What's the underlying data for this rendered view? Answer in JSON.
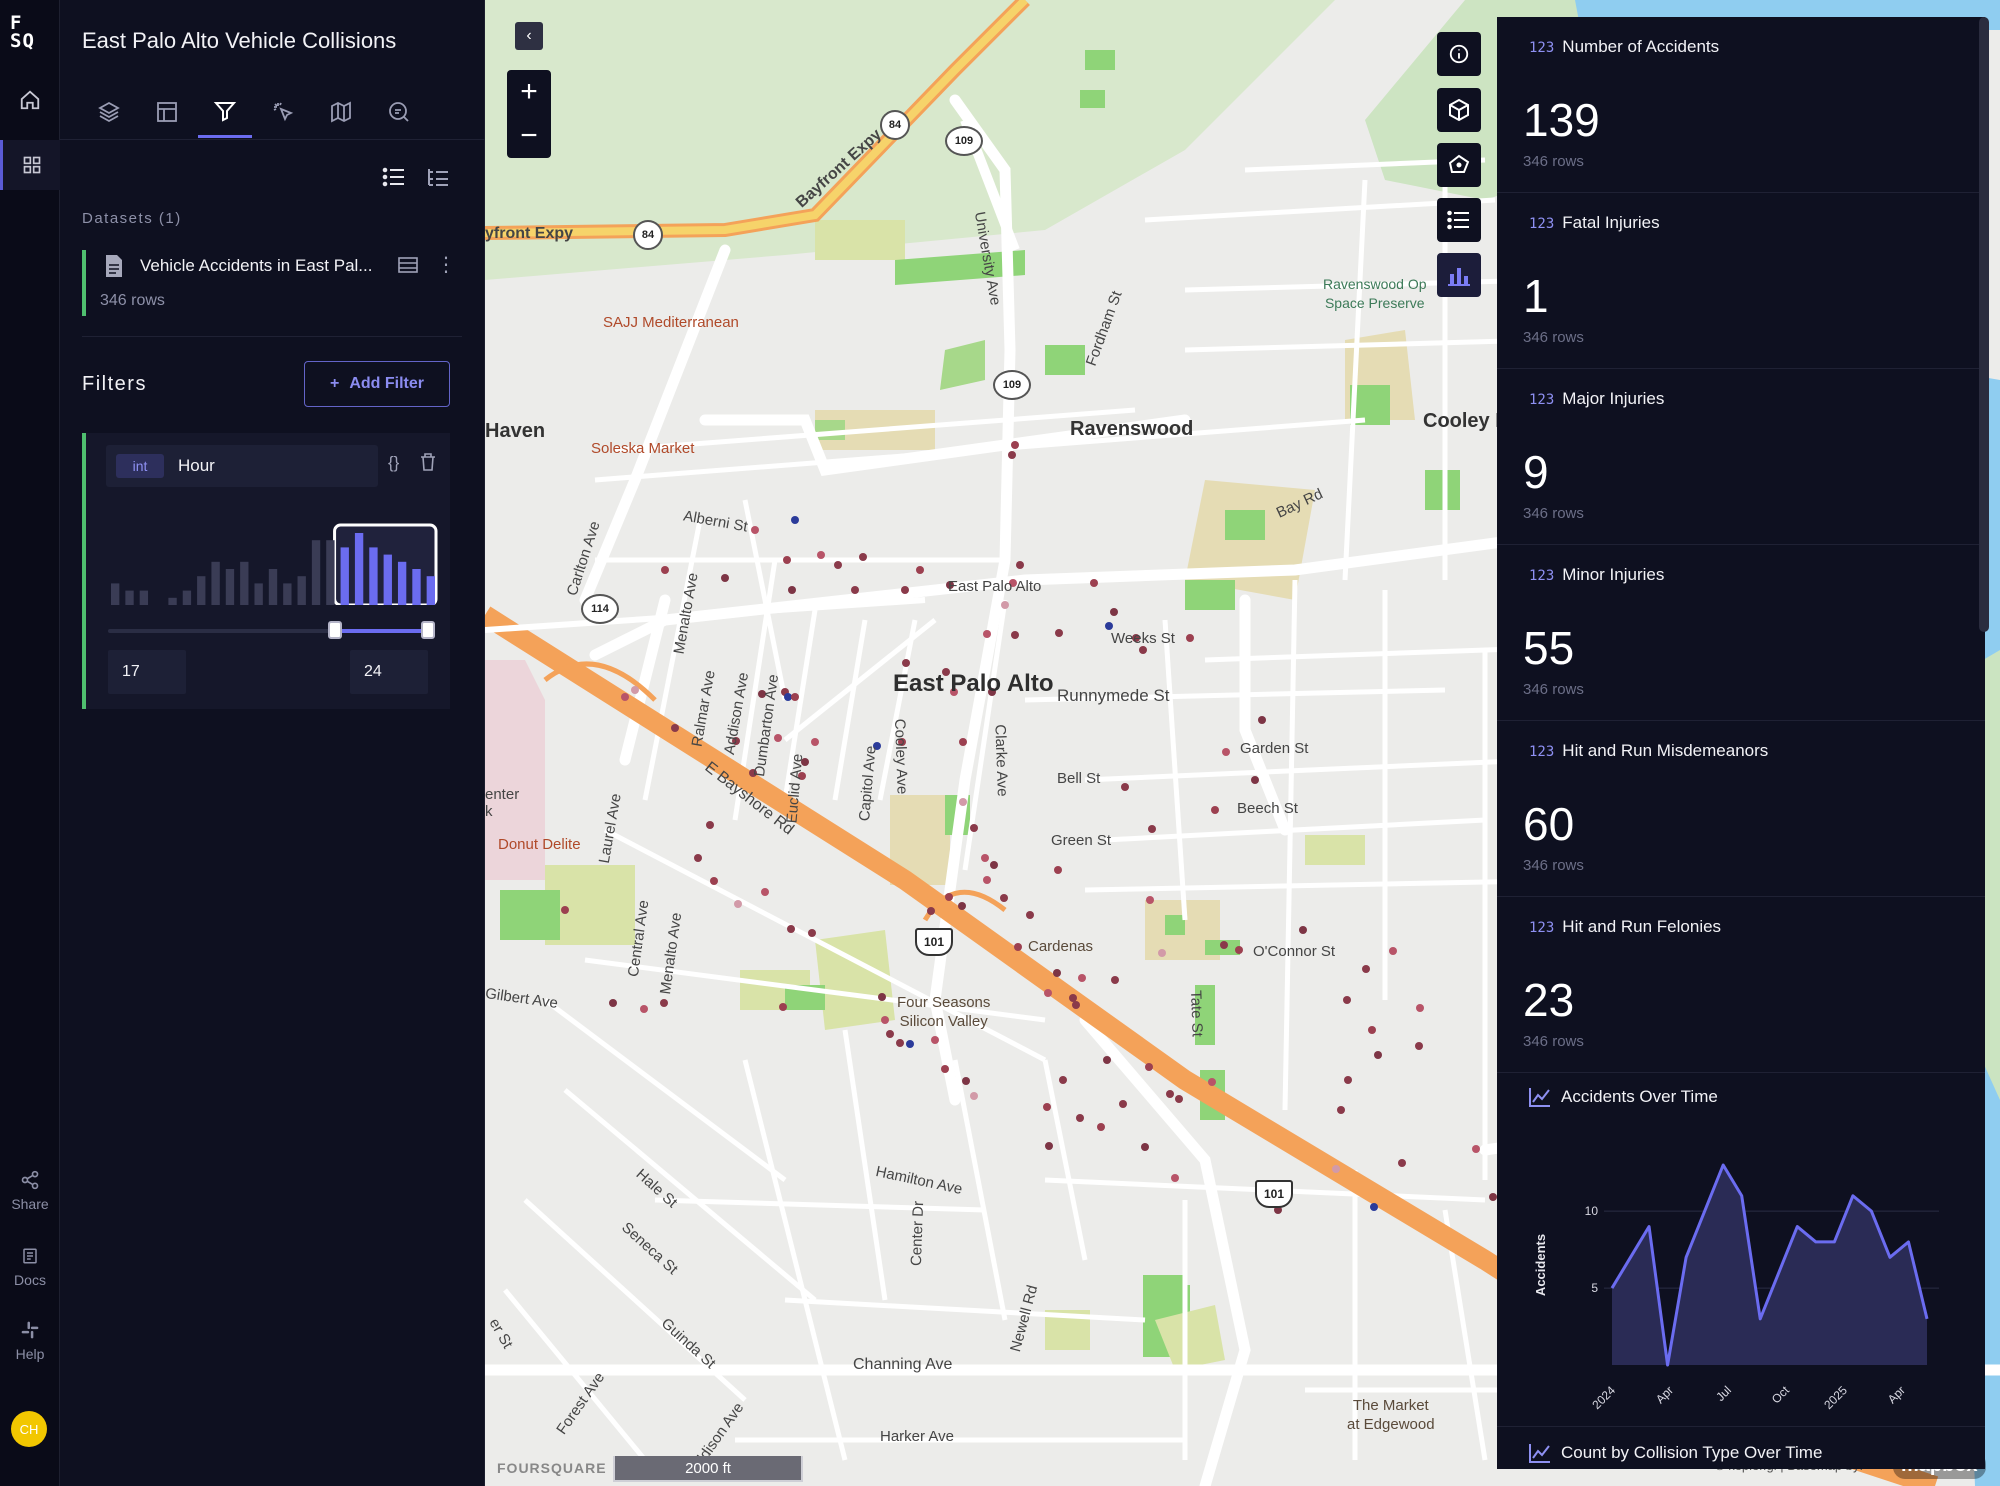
{
  "rail": {
    "logo": "F\nSQ",
    "share_label": "Share",
    "docs_label": "Docs",
    "help_label": "Help",
    "avatar_initials": "CH",
    "avatar_color": "#f2c700"
  },
  "panel": {
    "title": "East Palo Alto Vehicle Collisions",
    "tabs": [
      "layers-icon",
      "layout-icon",
      "filter-icon",
      "interaction-icon",
      "basemap-icon",
      "ai-assistant-icon"
    ],
    "active_tab": "filter-icon",
    "datasets_label": "Datasets (1)",
    "dataset": {
      "name": "Vehicle Accidents in East Pal...",
      "rows": "346 rows",
      "color": "#4fbf6f"
    },
    "filters_label": "Filters",
    "add_filter_label": "Add Filter",
    "filter": {
      "type": "int",
      "field": "Hour",
      "min_value": "17",
      "max_value": "24",
      "range_start_fraction": 0.708,
      "range_end_fraction": 1.0,
      "histogram": [
        3,
        2,
        2,
        0,
        1,
        2,
        4,
        6,
        5,
        6,
        3,
        5,
        3,
        4,
        9,
        9,
        8,
        10,
        8,
        7,
        6,
        5,
        4
      ]
    }
  },
  "map": {
    "labels": {
      "east_palo_alto": "East Palo Alto",
      "ravenswood": "Ravenswood",
      "haven": "Haven",
      "cooley": "Cooley L",
      "bayfront": "Bayfront Expy",
      "bayfront2": "yfront Expy",
      "university": "University Ave",
      "fordham": "Fordham St",
      "bay_rd": "Bay Rd",
      "alberni": "Alberni St",
      "carlton": "Carlton Ave",
      "menalto": "Menalto Ave",
      "ralmar": "Ralmar Ave",
      "addison": "Addison Ave",
      "dumbarton": "Dumbarton Ave",
      "euclid": "Euclid Ave",
      "capitol": "Capitol Ave",
      "cooley_ave": "Cooley Ave",
      "clarke": "Clarke Ave",
      "weeks": "Weeks St",
      "runnymede": "Runnymede St",
      "garden": "Garden St",
      "bell": "Bell St",
      "beech": "Beech St",
      "green": "Green St",
      "oconnor": "O'Connor St",
      "bayshore": "E Bayshore Rd",
      "laurel": "Laurel Ave",
      "central": "Central Ave",
      "menalto2": "Menalto Ave",
      "gilbert": "Gilbert Ave",
      "tate": "Tate St",
      "hamilton": "Hamilton Ave",
      "center_dr": "Center Dr",
      "newell": "Newell Rd",
      "hale": "Hale St",
      "seneca": "Seneca St",
      "guinda": "Guinda St",
      "forest": "Forest Ave",
      "addison2": "Addison Ave",
      "channing": "Channing Ave",
      "harker": "Harker Ave",
      "east_palo_alto_small": "East Palo Alto",
      "center_k": "enter\nk",
      "er_st": "er St"
    },
    "pois": {
      "sajj": "SAJJ Mediterranean",
      "soleska": "Soleska Market",
      "donut": "Donut Delite",
      "cardenas": "Cardenas",
      "four_seasons": "Four Seasons\nSilicon Valley",
      "market": "The Market\nat Edgewood",
      "ravenswood_os": "Ravenswood Op\nSpace Preserve"
    },
    "shields": [
      "84",
      "84",
      "109",
      "109",
      "114",
      "101",
      "101"
    ],
    "scale_label": "2000 ft",
    "watermark": "FOURSQUARE",
    "attribution": "© kepler.gl | Basemap by:",
    "mapbox_logo": "mapbox",
    "map_controls": [
      "info-icon",
      "3d-cube-icon",
      "draw-polygon-icon",
      "legend-list-icon",
      "widgets-chart-icon"
    ]
  },
  "widgets": [
    {
      "title": "Number of Accidents",
      "value": "139",
      "rows": "346 rows"
    },
    {
      "title": "Fatal Injuries",
      "value": "1",
      "rows": "346 rows"
    },
    {
      "title": "Major Injuries",
      "value": "9",
      "rows": "346 rows"
    },
    {
      "title": "Minor Injuries",
      "value": "55",
      "rows": "346 rows"
    },
    {
      "title": "Hit and Run Misdemeanors",
      "value": "60",
      "rows": "346 rows"
    },
    {
      "title": "Hit and Run Felonies",
      "value": "23",
      "rows": "346 rows"
    }
  ],
  "widget_type_badge": "123",
  "chart_data": {
    "type": "area",
    "title": "Accidents Over Time",
    "ylabel": "Accidents",
    "xlabel": "",
    "x_ticks": [
      "2024",
      "Apr",
      "Jul",
      "Oct",
      "2025",
      "Apr"
    ],
    "values": [
      5,
      7,
      9,
      0,
      7,
      10,
      13,
      11,
      3,
      6,
      9,
      8,
      8,
      11,
      10,
      7,
      8,
      3
    ],
    "ylim": [
      0,
      13
    ],
    "y_ticks": [
      "5",
      "10"
    ],
    "color": "#6b6cf0",
    "fill_color": "#2a2b55"
  },
  "next_widget_title": "Count by Collision Type Over Time"
}
